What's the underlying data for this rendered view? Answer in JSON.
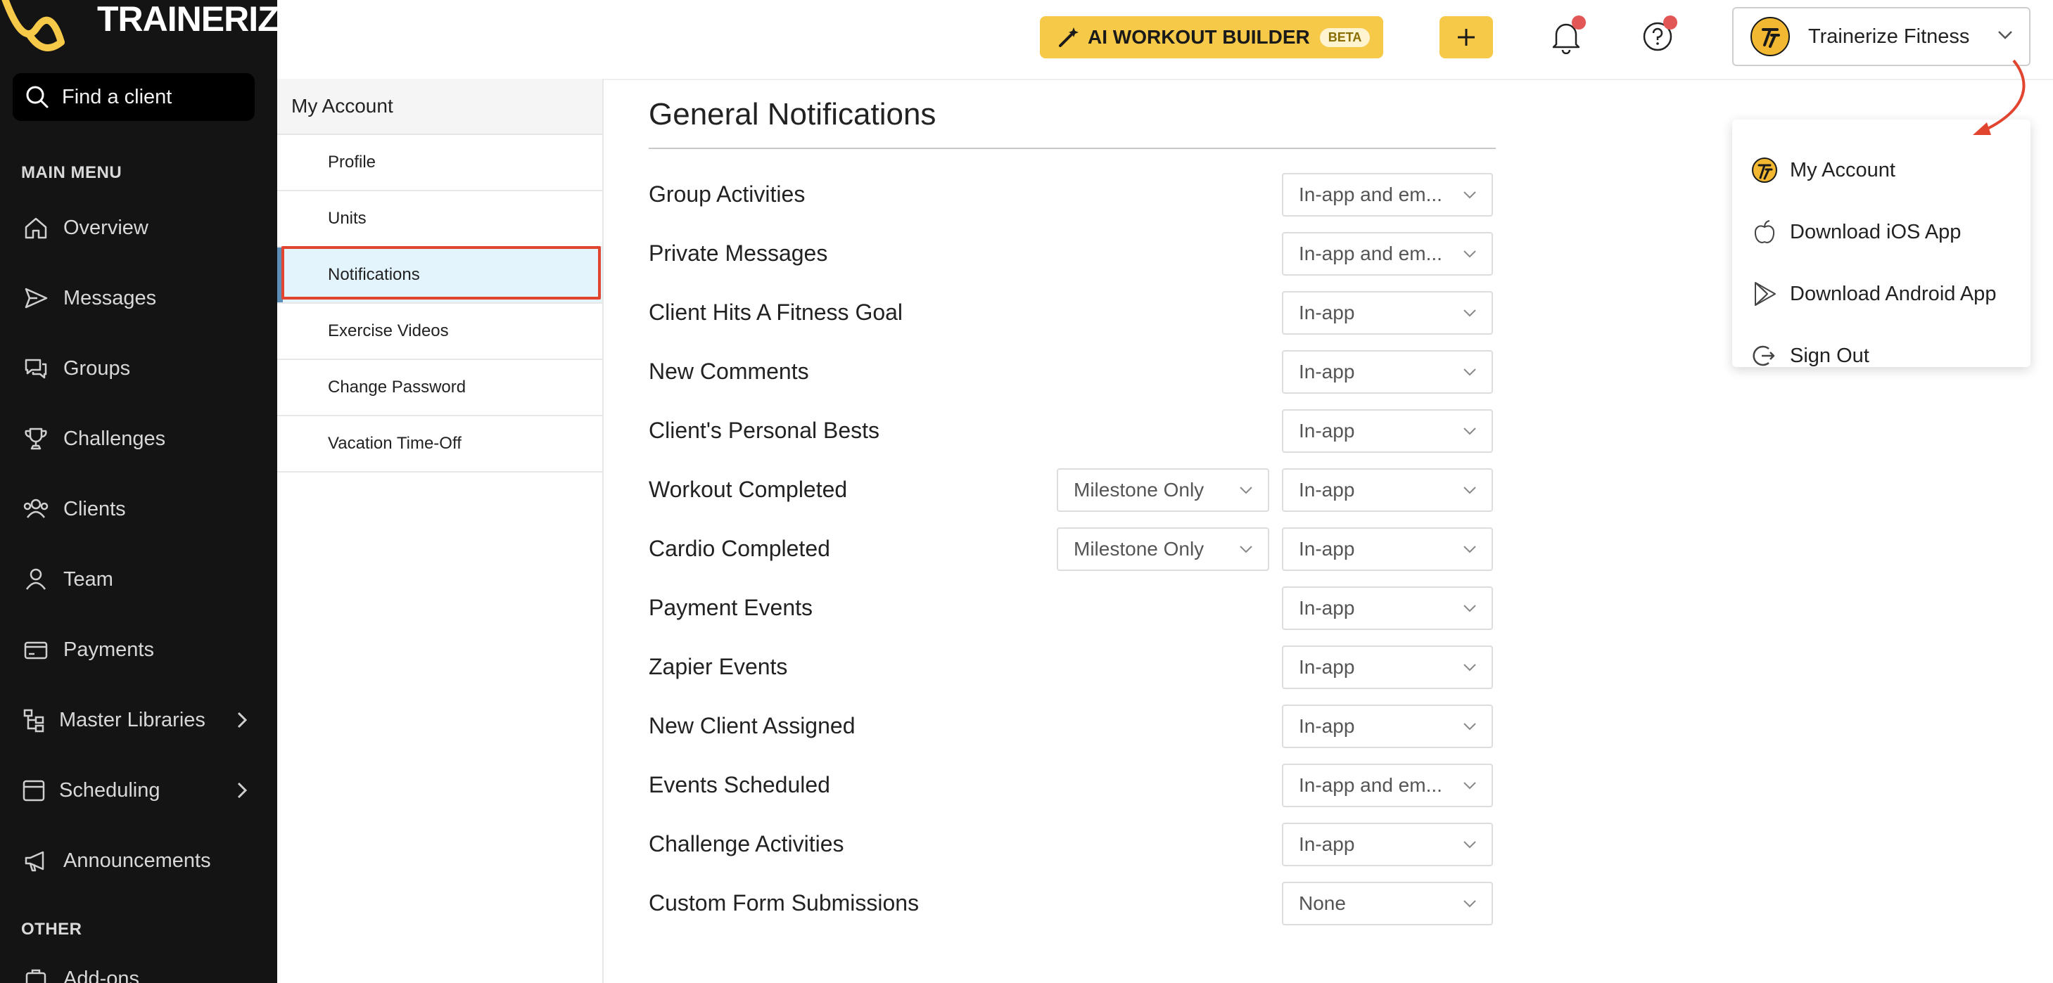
{
  "brand": {
    "name": "TRAINERIZE",
    "accent_color": "#f7c948"
  },
  "sidebar": {
    "search_label": "Find a client",
    "main_menu_label": "MAIN MENU",
    "other_label": "OTHER",
    "items": [
      {
        "label": "Overview",
        "icon": "home-icon"
      },
      {
        "label": "Messages",
        "icon": "send-icon"
      },
      {
        "label": "Groups",
        "icon": "chat-bubbles-icon"
      },
      {
        "label": "Challenges",
        "icon": "trophy-icon"
      },
      {
        "label": "Clients",
        "icon": "clients-icon"
      },
      {
        "label": "Team",
        "icon": "person-icon"
      },
      {
        "label": "Payments",
        "icon": "wallet-icon"
      },
      {
        "label": "Master Libraries",
        "icon": "hierarchy-icon"
      },
      {
        "label": "Scheduling",
        "icon": "calendar-icon"
      },
      {
        "label": "Announcements",
        "icon": "megaphone-icon"
      }
    ],
    "partial_item": "Add-ons"
  },
  "header": {
    "ai_button_label": "AI WORKOUT BUILDER",
    "beta_badge": "BETA",
    "account_name": "Trainerize Fitness"
  },
  "subnav": {
    "title": "My Account",
    "items": [
      "Profile",
      "Units",
      "Notifications",
      "Exercise Videos",
      "Change Password",
      "Vacation Time-Off"
    ],
    "active": "Notifications"
  },
  "main": {
    "title": "General Notifications",
    "rows": [
      {
        "label": "Group Activities",
        "value": "In-app and em..."
      },
      {
        "label": "Private Messages",
        "value": "In-app and em..."
      },
      {
        "label": "Client Hits A Fitness Goal",
        "value": "In-app"
      },
      {
        "label": "New Comments",
        "value": "In-app"
      },
      {
        "label": "Client's Personal Bests",
        "value": "In-app"
      },
      {
        "label": "Workout Completed",
        "milestone": "Milestone Only",
        "value": "In-app"
      },
      {
        "label": "Cardio Completed",
        "milestone": "Milestone Only",
        "value": "In-app"
      },
      {
        "label": "Payment Events",
        "value": "In-app"
      },
      {
        "label": "Zapier Events",
        "value": "In-app"
      },
      {
        "label": "New Client Assigned",
        "value": "In-app"
      },
      {
        "label": "Events Scheduled",
        "value": "In-app and em..."
      },
      {
        "label": "Challenge Activities",
        "value": "In-app"
      },
      {
        "label": "Custom Form Submissions",
        "value": "None"
      }
    ]
  },
  "dropdown": {
    "items": [
      {
        "label": "My Account",
        "icon": "brand-avatar-icon"
      },
      {
        "label": "Download iOS App",
        "icon": "apple-icon"
      },
      {
        "label": "Download Android App",
        "icon": "play-store-icon"
      },
      {
        "label": "Sign Out",
        "icon": "sign-out-icon"
      }
    ]
  }
}
